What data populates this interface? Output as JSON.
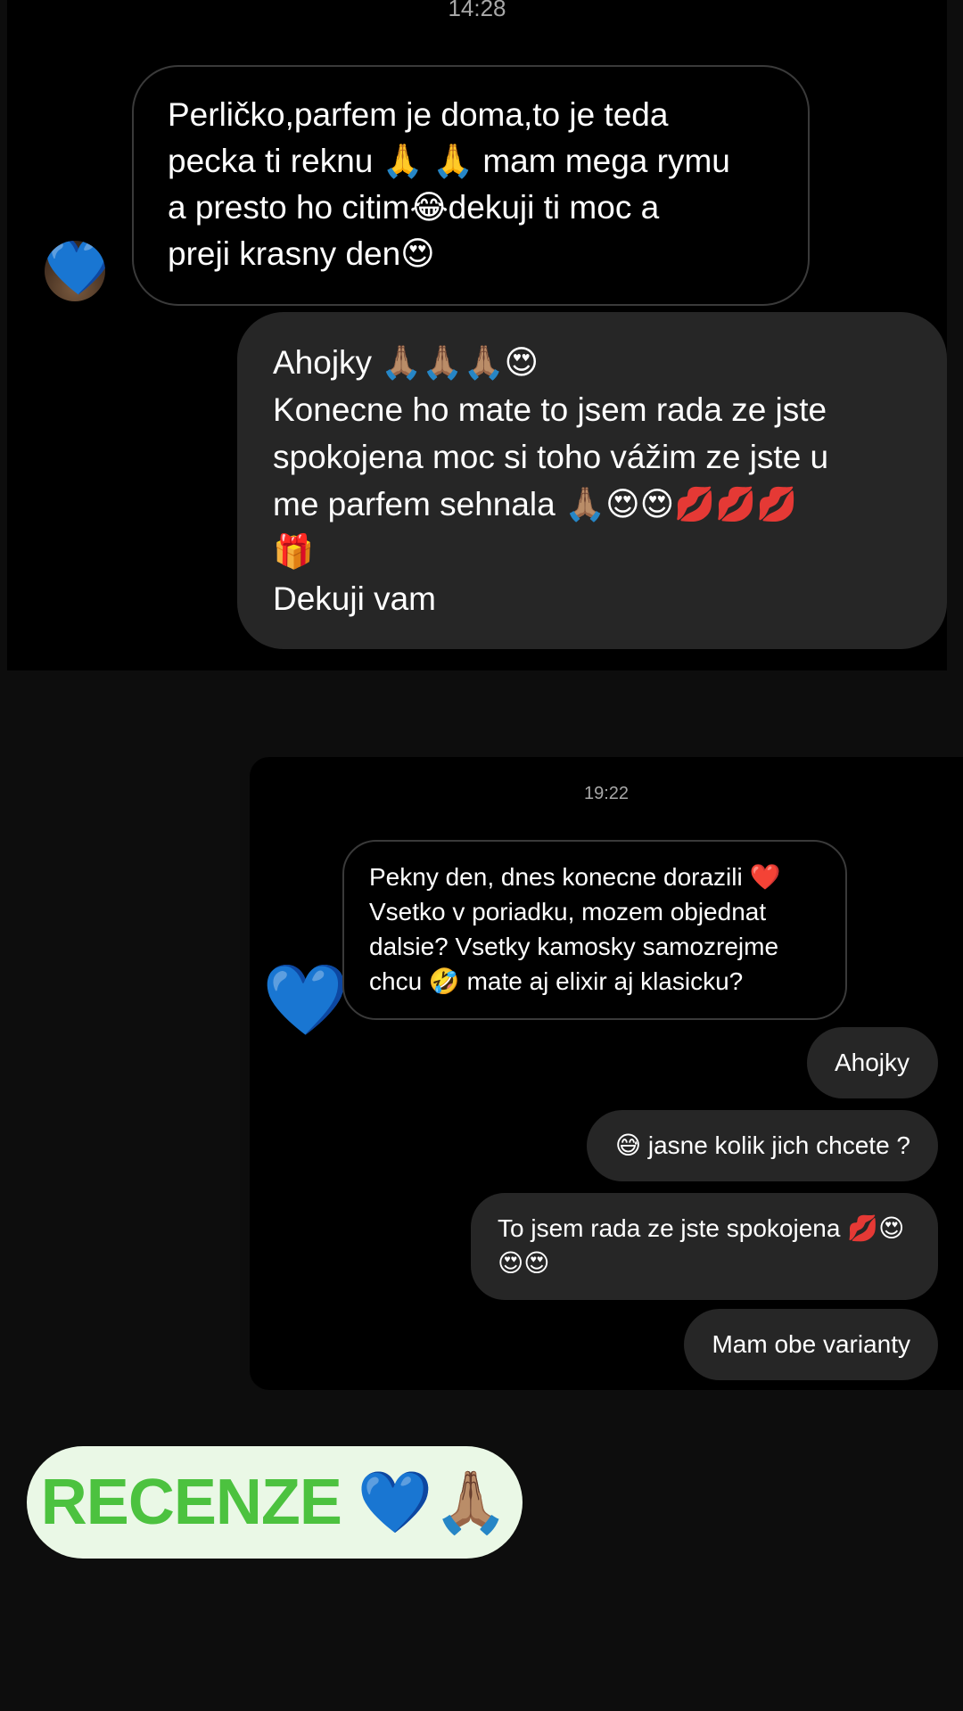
{
  "screenshot_1": {
    "timestamp": "14:28",
    "incoming_message": {
      "lines": [
        "Perličko,parfem je doma,to je teda",
        "pecka ti reknu 🙏 🙏 mam mega rymu",
        "a presto ho citim😂dekuji ti moc a",
        "preji krasny den😍"
      ],
      "avatar_icon": "blue-heart"
    },
    "outgoing_message": {
      "lines": [
        "Ahojky 🙏🏽🙏🏽🙏🏽😍",
        "Konecne ho mate to jsem rada ze jste",
        "spokojena moc si toho vážim ze jste u",
        "me parfem sehnala 🙏🏽😍😍💋💋💋",
        "🎁",
        "Dekuji vam"
      ]
    }
  },
  "screenshot_2": {
    "timestamp": "19:22",
    "avatar_emoji": "💙",
    "incoming_message": {
      "lines": [
        "Pekny den, dnes konecne dorazili ❤️",
        "Vsetko v poriadku, mozem objednat",
        "dalsie? Vsetky kamosky samozrejme",
        "chcu 🤣 mate aj elixir aj klasicku?"
      ]
    },
    "outgoing_messages": [
      "Ahojky",
      "😅 jasne kolik jich chcete ?",
      "To jsem rada ze jste spokojena 💋😍 😍😍",
      "Mam obe varianty"
    ]
  },
  "label": {
    "text": "RECENZE",
    "emojis": "💙🙏🏽",
    "text_color": "#4cc23f",
    "background_color": "#eaf8e6"
  }
}
